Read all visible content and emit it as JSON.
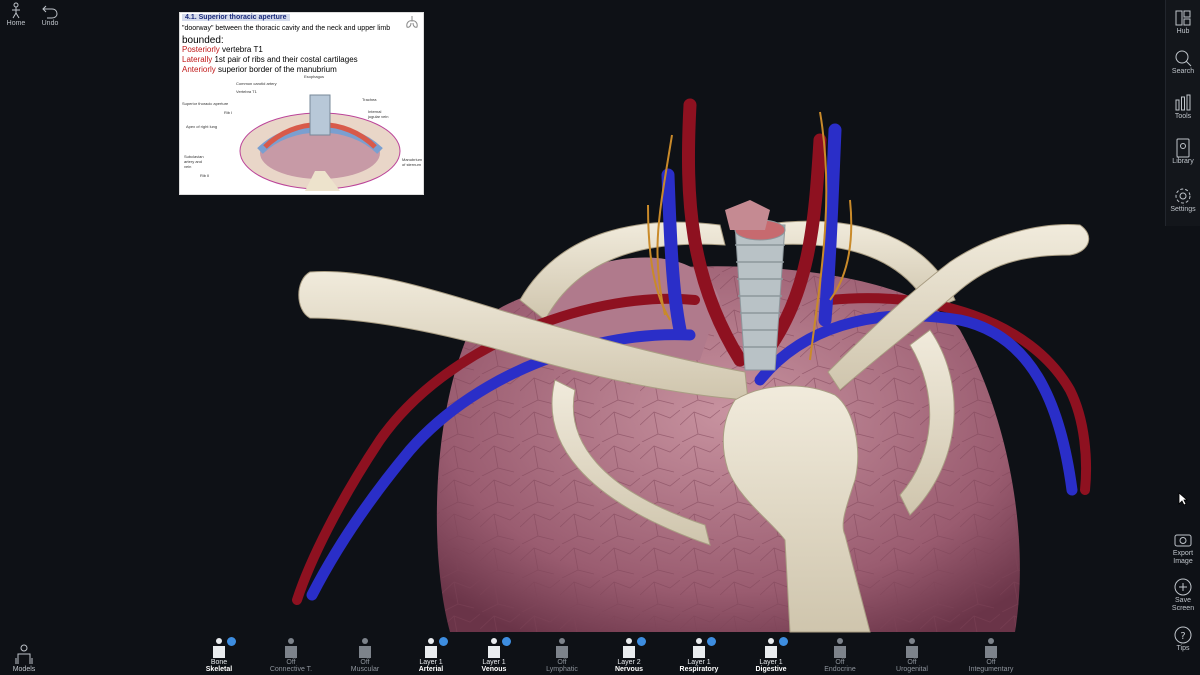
{
  "toolbar": {
    "home_label": "Home",
    "undo_label": "Undo"
  },
  "sidebar": {
    "items": [
      {
        "label": "Hub",
        "icon": "hub-icon"
      },
      {
        "label": "Search",
        "icon": "search-icon"
      },
      {
        "label": "Tools",
        "icon": "tools-icon"
      },
      {
        "label": "Library",
        "icon": "library-icon"
      },
      {
        "label": "Settings",
        "icon": "gear-icon"
      }
    ]
  },
  "side_actions": {
    "export_label": "Export Image",
    "save_label": "Save Screen",
    "tips_label": "Tips"
  },
  "slide": {
    "title": "4.1. Superior thoracic aperture",
    "line1": "\"doorway\" between the thoracic cavity and the neck and upper limb",
    "line2": "bounded:",
    "line3_red": "Posteriorly",
    "line3": " vertebra T1",
    "line4_red": "Laterally",
    "line4": " 1st pair of ribs and their costal cartilages",
    "line5_red": "Anteriorly",
    "line5": " superior border of the manubrium",
    "labels": [
      "Esophagus",
      "Common carotid artery",
      "Vertebra T1",
      "Superior thoracic aperture",
      "Rib I",
      "Apex of right lung",
      "Subclavian artery and vein",
      "Rib II",
      "Trachea",
      "Internal jugular vein",
      "Manubrium of sternum"
    ]
  },
  "bottom": {
    "models_label": "Models",
    "layers": [
      {
        "status": "Bone",
        "name": "Skeletal",
        "on": true
      },
      {
        "status": "Off",
        "name": "Connective T.",
        "on": false
      },
      {
        "status": "Off",
        "name": "Muscular",
        "on": false
      },
      {
        "status": "Layer 1",
        "name": "Arterial",
        "on": true
      },
      {
        "status": "Layer 1",
        "name": "Venous",
        "on": true
      },
      {
        "status": "Off",
        "name": "Lymphatic",
        "on": false
      },
      {
        "status": "Layer 2",
        "name": "Nervous",
        "on": true
      },
      {
        "status": "Layer 1",
        "name": "Respiratory",
        "on": true
      },
      {
        "status": "Layer 1",
        "name": "Digestive",
        "on": true
      },
      {
        "status": "Off",
        "name": "Endocrine",
        "on": false
      },
      {
        "status": "Off",
        "name": "Urogenital",
        "on": false
      },
      {
        "status": "Off",
        "name": "Integumentary",
        "on": false
      }
    ]
  },
  "colors": {
    "background": "#0e1116",
    "artery": "#8e1120",
    "vein": "#2a2ec8",
    "bone": "#e8e1cf",
    "lung": "#a86a7c",
    "accent": "#3d8de0"
  }
}
